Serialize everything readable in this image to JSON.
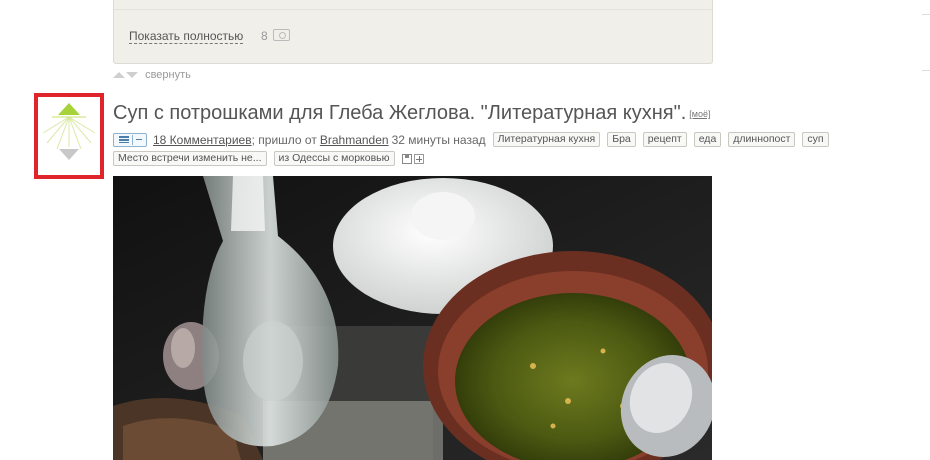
{
  "previous_post": {
    "show_full_label": "Показать полностью",
    "image_count": "8",
    "camera_icon": "camera-icon"
  },
  "collapse": {
    "label": "свернуть"
  },
  "post": {
    "title": "Суп с потрошками для Глеба Жеглова. \"Литературная кухня\".",
    "mine_label": "[моё]",
    "comments_link": "18 Комментариев",
    "came_from": "; пришло от",
    "author": "Brahmanden",
    "time_ago": "32 минуты назад",
    "tags": [
      "Литературная кухня",
      "Бра",
      "рецепт",
      "еда",
      "длиннопост",
      "суп"
    ],
    "tags_row2": [
      "Место встречи изменить не...",
      "из Одессы с морковью"
    ]
  },
  "colors": {
    "vote_up": "#a6d23a",
    "vote_down": "#c8c8c8",
    "highlight_frame": "#e0242b",
    "link": "#555555"
  }
}
